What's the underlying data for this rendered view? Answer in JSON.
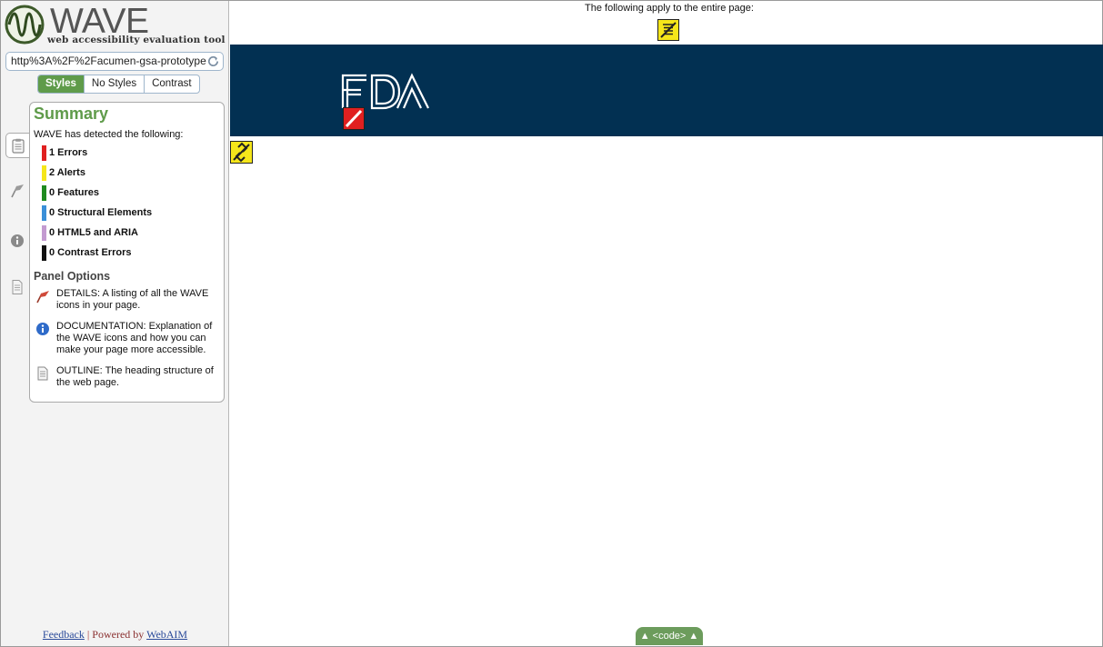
{
  "app": {
    "logo_text": "WAVE",
    "tagline": "web accessibility evaluation tool"
  },
  "url_bar": {
    "value": "http%3A%2F%2Facumen-gsa-prototype"
  },
  "view_tabs": [
    "Styles",
    "No Styles",
    "Contrast"
  ],
  "summary": {
    "title": "Summary",
    "subtitle": "WAVE has detected the following:",
    "counts": [
      {
        "label": "1 Errors",
        "color": "#e02020"
      },
      {
        "label": "2 Alerts",
        "color": "#f5e61a"
      },
      {
        "label": "0 Features",
        "color": "#1f8a1f"
      },
      {
        "label": "0 Structural Elements",
        "color": "#3a8fd8"
      },
      {
        "label": "0 HTML5 and ARIA",
        "color": "#c39ad0"
      },
      {
        "label": "0 Contrast Errors",
        "color": "#111111"
      }
    ]
  },
  "panel_options": {
    "title": "Panel Options",
    "items": [
      {
        "text": "DETAILS: A listing of all the WAVE icons in your page.",
        "icon": "flag-icon"
      },
      {
        "text": "DOCUMENTATION: Explanation of the WAVE icons and how you can make your page more accessible.",
        "icon": "info-icon"
      },
      {
        "text": "OUTLINE: The heading structure of the web page.",
        "icon": "document-icon"
      }
    ]
  },
  "footer": {
    "feedback": "Feedback",
    "separator": "|",
    "powered_by": "Powered by",
    "webaim": "WebAIM"
  },
  "main": {
    "page_note": "The following apply to the entire page:",
    "code_toggle": "▲ <code> ▲",
    "banner_color": "#023052",
    "logo_text": "FDA"
  }
}
